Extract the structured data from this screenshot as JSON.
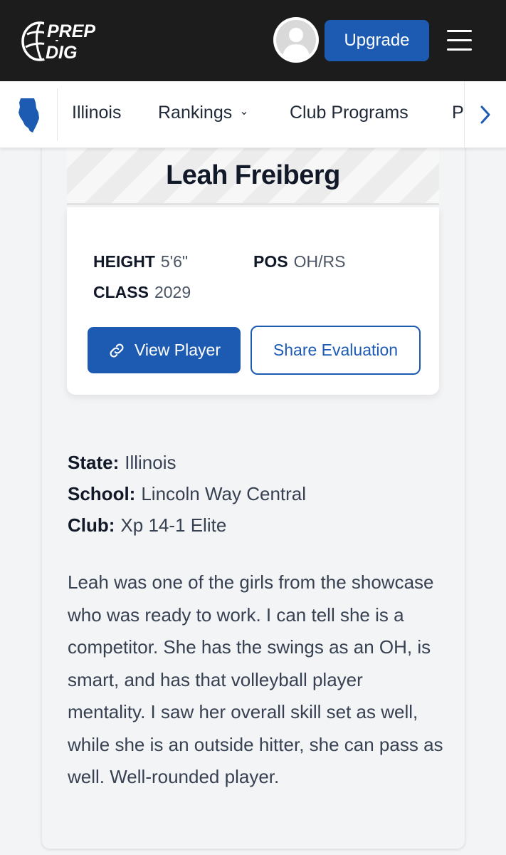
{
  "header": {
    "logo_line1": "PREP",
    "logo_line2": "DIG",
    "upgrade_label": "Upgrade",
    "avatar_icon": "user-avatar-placeholder",
    "menu_icon": "hamburger-menu-icon"
  },
  "subnav": {
    "state_icon": "illinois-state-icon",
    "items": [
      {
        "label": "Illinois"
      },
      {
        "label": "Rankings",
        "has_dropdown": true
      },
      {
        "label": "Club Programs"
      },
      {
        "label": "P"
      }
    ],
    "scroll_icon": "chevron-right-icon"
  },
  "player": {
    "name": "Leah Freiberg",
    "height_label": "HEIGHT",
    "height_value": "5'6\"",
    "pos_label": "POS",
    "pos_value": "OH/RS",
    "class_label": "CLASS",
    "class_value": "2029",
    "view_label": "View Player",
    "share_label": "Share Evaluation"
  },
  "details": {
    "state_label": "State:",
    "state_value": "Illinois",
    "school_label": "School:",
    "school_value": "Lincoln Way Central",
    "club_label": "Club:",
    "club_value": "Xp 14-1 Elite"
  },
  "evaluation": "Leah was one of the girls from the showcase who was ready to work. I can tell she is a competitor. She has the swings as an OH, is smart, and has that volleyball player mentality. I saw her overall skill set as well, while she is an outside hitter, she can pass as well. Well-rounded player.",
  "colors": {
    "brand_blue": "#1d5bb3",
    "header_bg": "#1c1c1c",
    "page_bg": "#f3f4f6"
  }
}
